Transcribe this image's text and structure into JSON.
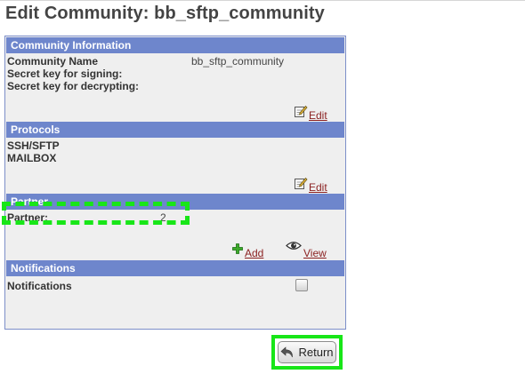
{
  "page": {
    "title": "Edit Community: bb_sftp_community"
  },
  "community_info": {
    "header": "Community Information",
    "rows": [
      {
        "label": "Community Name",
        "value": "bb_sftp_community"
      },
      {
        "label": "Secret key for signing:",
        "value": ""
      },
      {
        "label": "Secret key for decrypting:",
        "value": ""
      }
    ],
    "edit_label": "Edit"
  },
  "protocols": {
    "header": "Protocols",
    "items": [
      "SSH/SFTP",
      "MAILBOX"
    ],
    "edit_label": "Edit"
  },
  "partner": {
    "header": "Partner",
    "label": "Partner:",
    "count": "2",
    "add_label": "Add",
    "view_label": "View"
  },
  "notifications": {
    "header": "Notifications",
    "label": "Notifications",
    "checked": false
  },
  "actions": {
    "return_label": "Return"
  },
  "colors": {
    "section_header_bg": "#6e86cc",
    "panel_bg": "#efefef",
    "link": "#8a1f1f",
    "highlight": "#18e618"
  }
}
